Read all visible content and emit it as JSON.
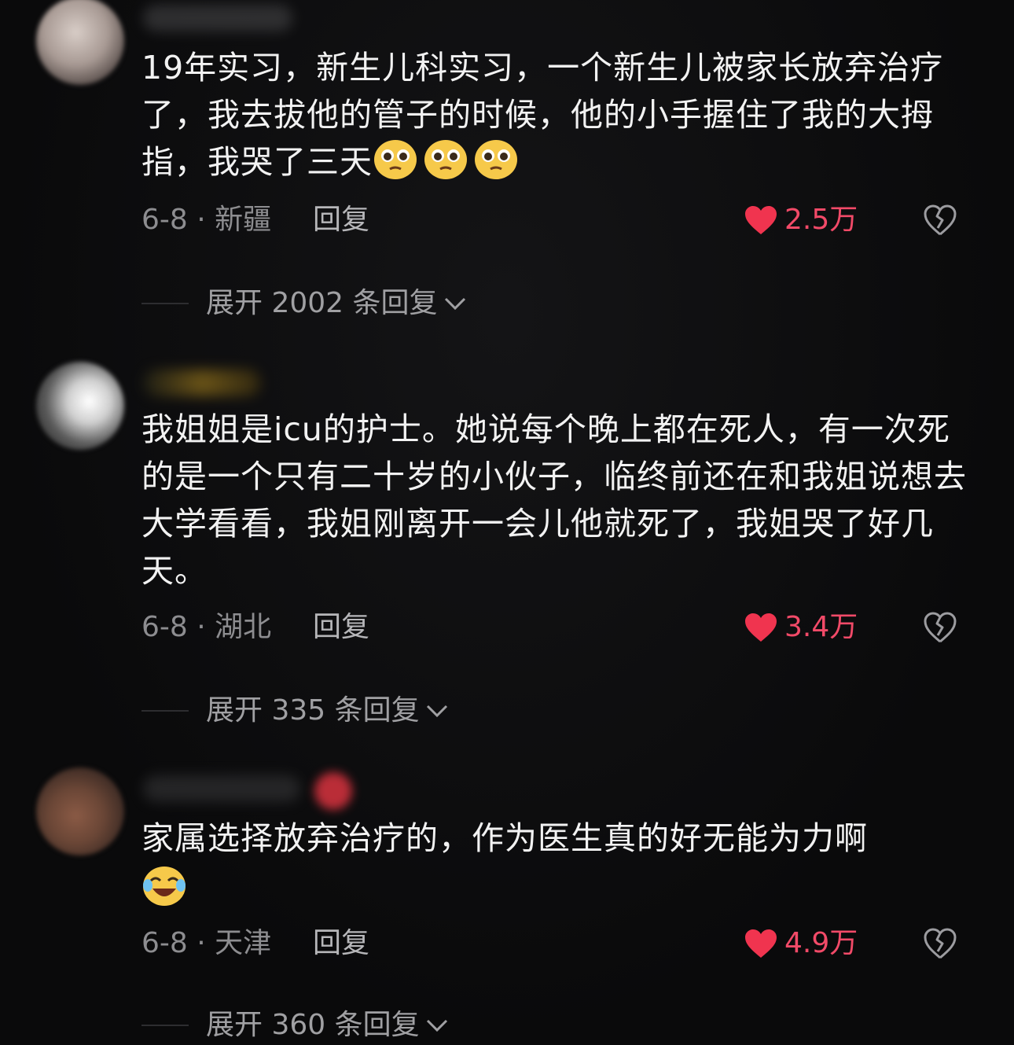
{
  "comments": [
    {
      "text": "19年实习，新生儿科实习，一个新生儿被家长放弃治疗了，我去拔他的管子的时候，他的小手握住了我的大拇指，我哭了三天",
      "emoji": "pleading-face-emoji x3",
      "date_location": "6-8 · 新疆",
      "reply_label": "回复",
      "like_count": "2.5万",
      "expand_label": "展开 2002 条回复"
    },
    {
      "text": "我姐姐是icu的护士。她说每个晚上都在死人，有一次死的是一个只有二十岁的小伙子，临终前还在和我姐说想去大学看看，我姐刚离开一会儿他就死了，我姐哭了好几天。",
      "date_location": "6-8 · 湖北",
      "reply_label": "回复",
      "like_count": "3.4万",
      "expand_label": "展开 335 条回复"
    },
    {
      "text": "家属选择放弃治疗的，作为医生真的好无能为力啊",
      "emoji": "crying-laughing-emoji",
      "date_location": "6-8 · 天津",
      "reply_label": "回复",
      "like_count": "4.9万",
      "expand_label": "展开 360 条回复"
    }
  ],
  "colors": {
    "background": "#0b0b0c",
    "like_red": "#f24a68",
    "meta_gray": "#8d8d90"
  }
}
